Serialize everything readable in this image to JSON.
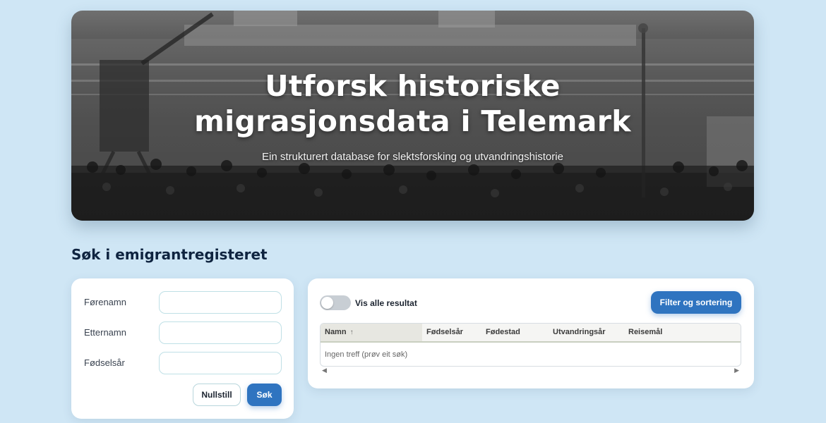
{
  "hero": {
    "title_line1": "Utforsk historiske",
    "title_line2": "migrasjonsdata i Telemark",
    "subtitle": "Ein strukturert database for slektsforsking og utvandringshistorie"
  },
  "search": {
    "heading": "Søk i emigrantregisteret",
    "fields": [
      {
        "label": "Førenamn",
        "value": ""
      },
      {
        "label": "Etternamn",
        "value": ""
      },
      {
        "label": "Fødselsår",
        "value": ""
      }
    ],
    "reset_label": "Nullstill",
    "search_label": "Søk"
  },
  "results": {
    "toggle_label": "Vis alle resultat",
    "toggle_on": false,
    "filter_label": "Filter og sortering",
    "columns": [
      "Namn",
      "Fødselsår",
      "Fødestad",
      "Utvandringsår",
      "Reisemål"
    ],
    "sort_indicator": "↑",
    "empty_text": "Ingen treff (prøv eit søk)"
  },
  "colors": {
    "page_bg": "#cfe6f5",
    "accent": "#2f74c0",
    "heading": "#0f2440"
  },
  "icons": {
    "sort": "arrow-up-icon",
    "scroll_left": "triangle-left-icon",
    "scroll_right": "triangle-right-icon"
  }
}
